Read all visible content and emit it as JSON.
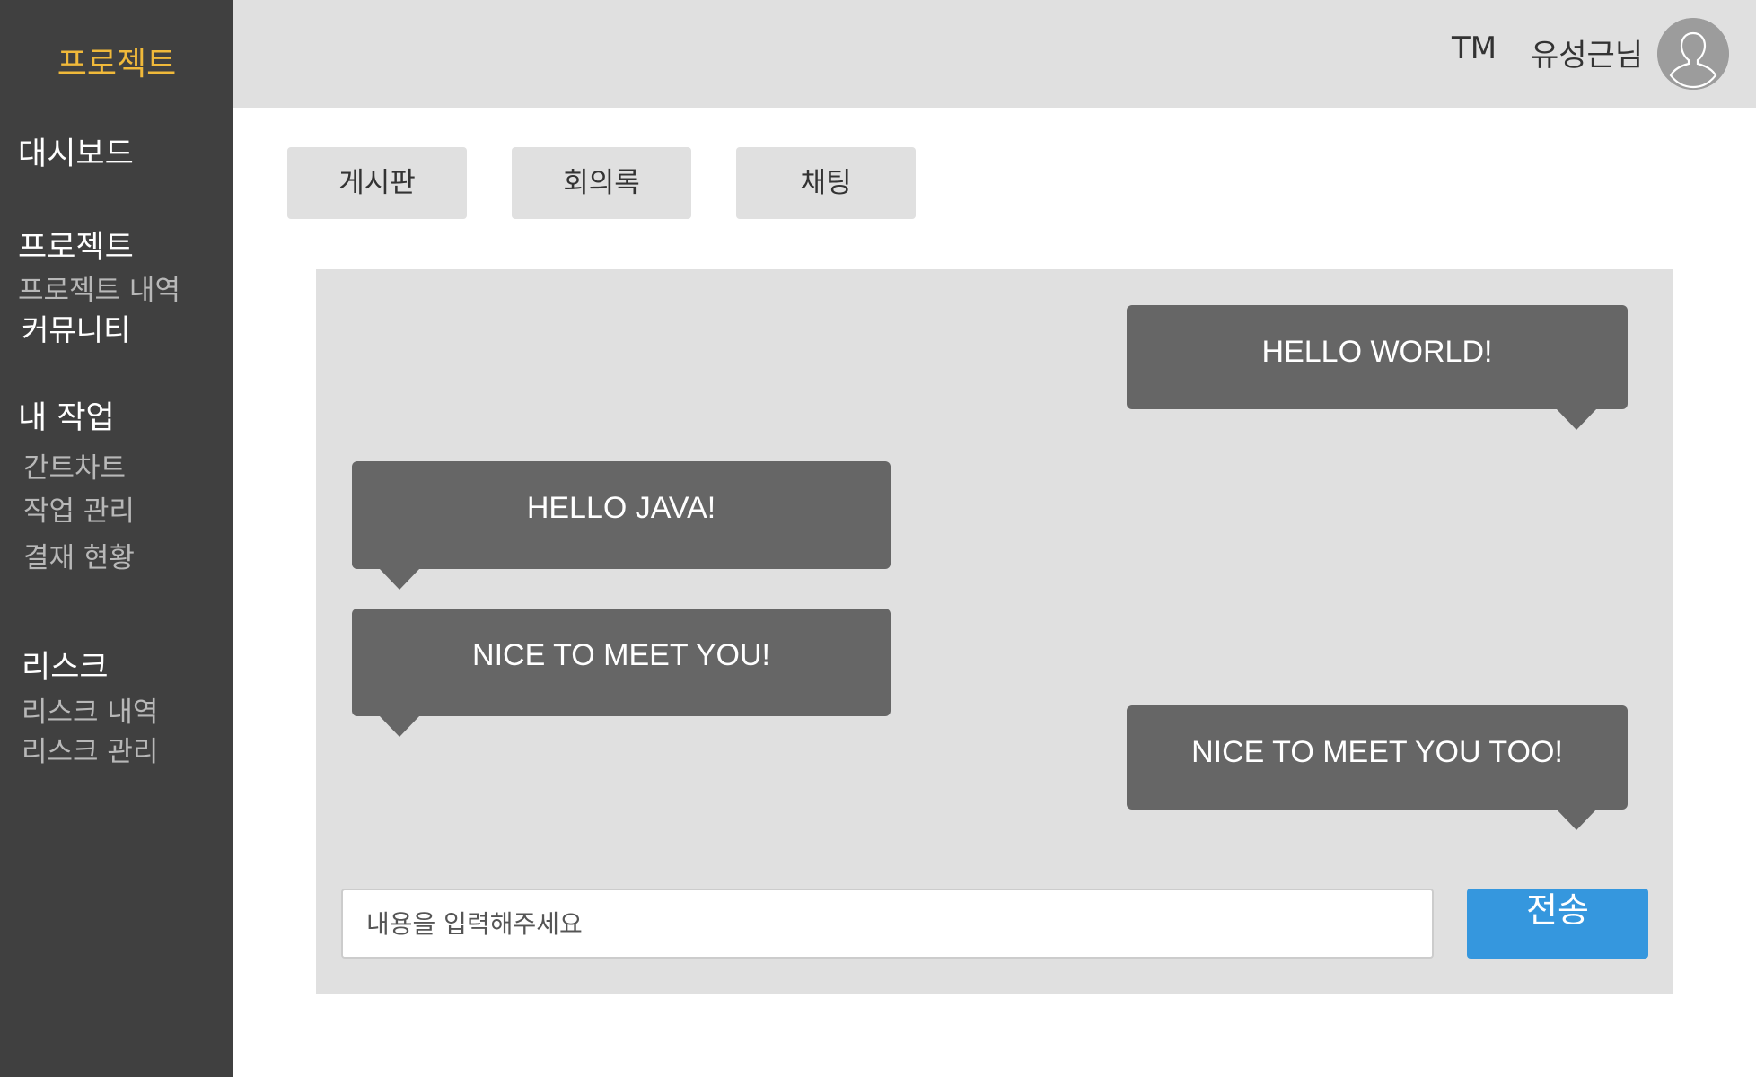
{
  "sidebar": {
    "brand": "프로젝트",
    "dashboard": "대시보드",
    "project": {
      "title": "프로젝트",
      "items": [
        "프로젝트 내역",
        "커뮤니티"
      ]
    },
    "my_work": {
      "title": "내 작업",
      "items": [
        "간트차트",
        "작업 관리",
        "결재 현황"
      ]
    },
    "risk": {
      "title": "리스크",
      "items": [
        "리스크 내역",
        "리스크 관리"
      ]
    }
  },
  "header": {
    "team": "TM",
    "user_name": "유성근님"
  },
  "tabs": [
    "게시판",
    "회의록",
    "채팅"
  ],
  "chat": {
    "messages": [
      {
        "text": "HELLO WORLD!",
        "side": "right"
      },
      {
        "text": "HELLO JAVA!",
        "side": "left"
      },
      {
        "text": "NICE TO MEET YOU!",
        "side": "left"
      },
      {
        "text": "NICE TO MEET YOU TOO!",
        "side": "right"
      }
    ],
    "input_placeholder": "내용을 입력해주세요",
    "send_label": "전송"
  },
  "colors": {
    "sidebar_bg": "#404040",
    "brand": "#f0b93a",
    "bubble": "#666666",
    "send_button": "#3597de",
    "panel_bg": "#e0e0e0"
  }
}
